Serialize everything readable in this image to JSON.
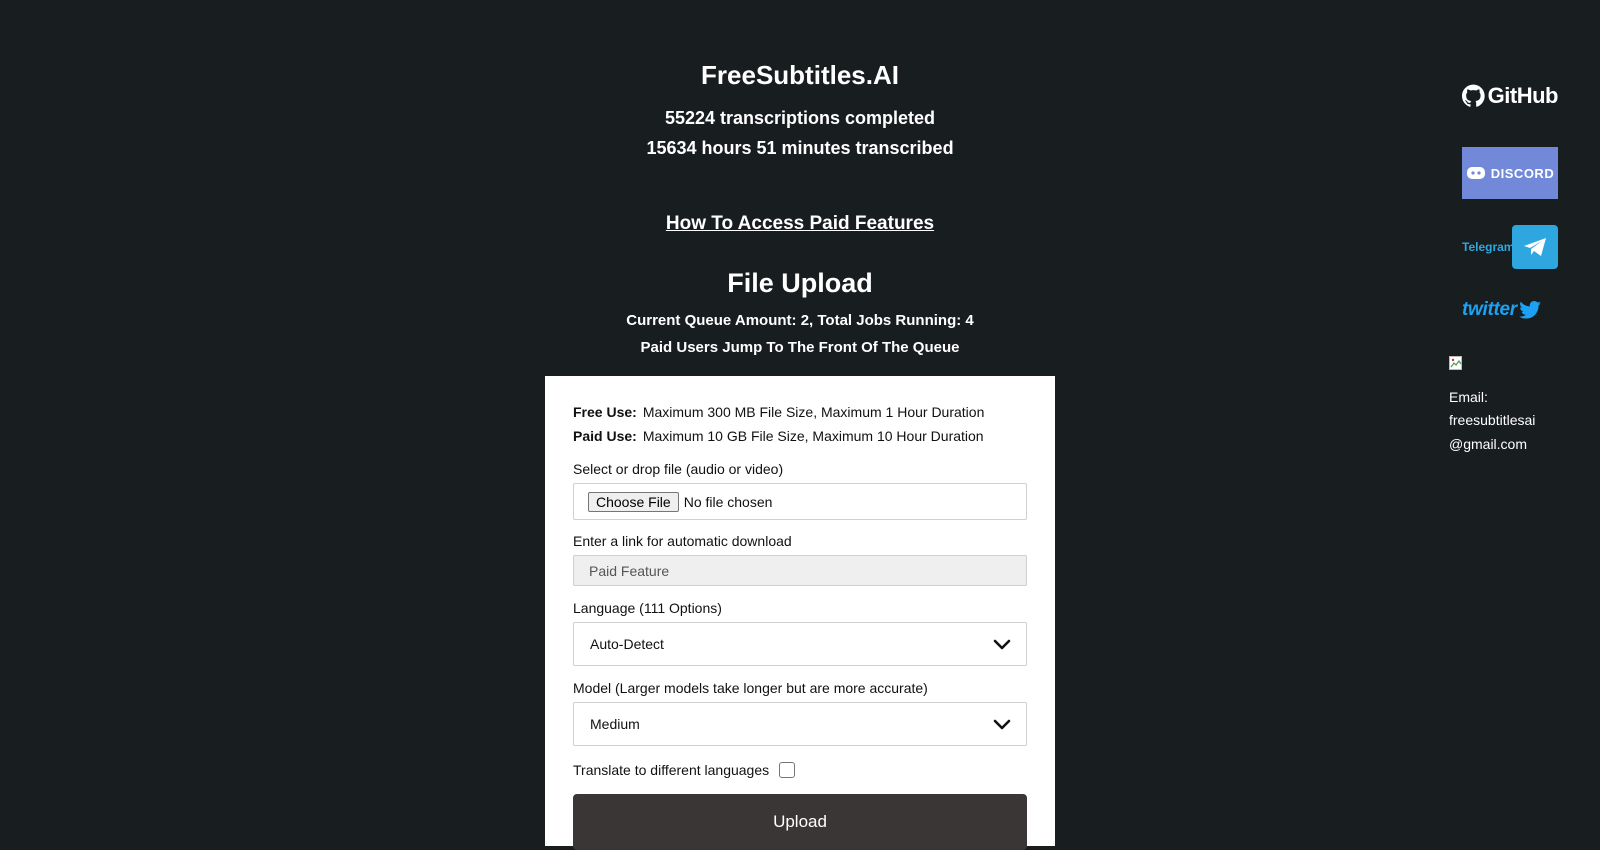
{
  "header": {
    "site_title": "FreeSubtitles.AI",
    "transcriptions_stat": "55224 transcriptions completed",
    "hours_stat": "15634 hours 51 minutes transcribed",
    "paid_features_link": "How To Access Paid Features"
  },
  "upload": {
    "heading": "File Upload",
    "queue_info": "Current Queue Amount: 2, Total Jobs Running: 4",
    "paid_priority": "Paid Users Jump To The Front Of The Queue",
    "free_label": "Free Use:",
    "free_limits": "Maximum 300 MB File Size, Maximum 1 Hour Duration",
    "paid_label": "Paid Use:",
    "paid_limits": "Maximum 10 GB File Size, Maximum 10 Hour Duration",
    "file_label": "Select or drop file (audio or video)",
    "choose_file_button": "Choose File",
    "file_status": "No file chosen",
    "link_label": "Enter a link for automatic download",
    "link_placeholder": "Paid Feature",
    "language_label": "Language (111 Options)",
    "language_value": "Auto-Detect",
    "model_label": "Model (Larger models take longer but are more accurate)",
    "model_value": "Medium",
    "translate_label": "Translate to different languages",
    "translate_checked": false,
    "upload_button": "Upload"
  },
  "sidebar": {
    "github_label": "GitHub",
    "discord_label": "DISCORD",
    "telegram_label": "Telegram",
    "twitter_label": "twitter",
    "email_label": "Email:",
    "email_line1": "freesubtitlesai",
    "email_line2": "@gmail.com"
  },
  "colors": {
    "background": "#181d1f",
    "card": "#ffffff",
    "upload_button": "#3a3635",
    "discord": "#7289da",
    "telegram": "#2ea6e0",
    "twitter": "#1da1f2"
  }
}
